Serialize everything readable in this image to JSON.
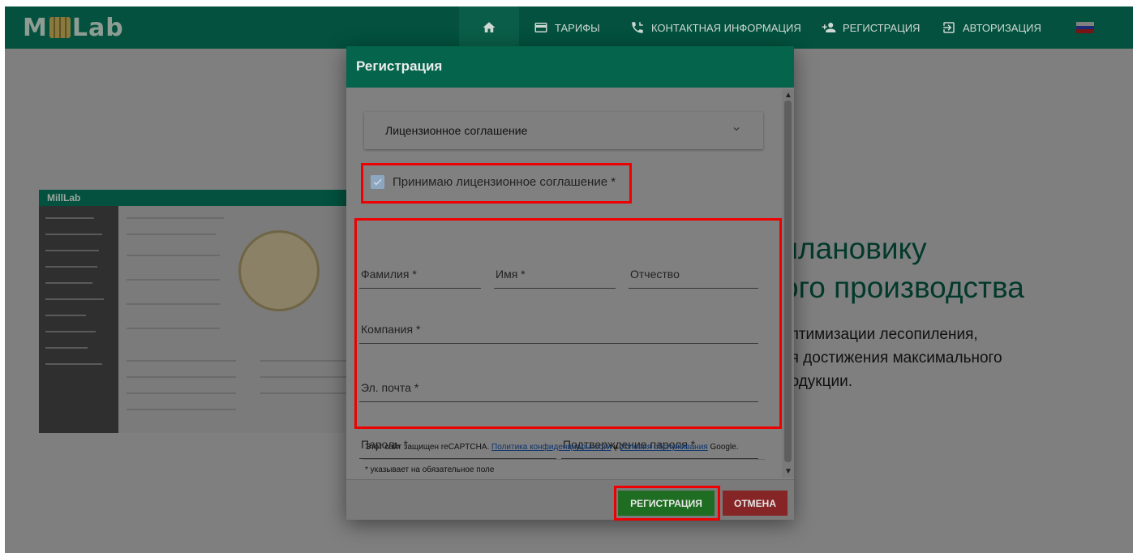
{
  "navbar": {
    "logo": "MillLab",
    "items": [
      {
        "label": "ТАРИФЫ"
      },
      {
        "label": "КОНТАКТНАЯ ИНФОРМАЦИЯ"
      },
      {
        "label": "РЕГИСТРАЦИЯ"
      },
      {
        "label": "АВТОРИЗАЦИЯ"
      }
    ],
    "language": "ru"
  },
  "hero": {
    "title_line1": "плановику",
    "title_line2": "ого производства",
    "sub_line1": "оптимизации лесопиления,",
    "sub_line2": "ия достижения максимального",
    "sub_line3": "родукции."
  },
  "modal": {
    "title": "Регистрация",
    "accordion_label": "Лицензионное соглашение",
    "agree_label": "Принимаю лицензионное соглашение *",
    "agree_checked": true,
    "fields": {
      "last_name": "Фамилия *",
      "first_name": "Имя *",
      "middle_name": "Отчество",
      "company": "Компания *",
      "email": "Эл. почта *",
      "password": "Пароль *",
      "password_confirm": "Подтверждение пароля *"
    },
    "recaptcha_prefix": "Этот сайт защищен reCAPTCHA.",
    "privacy_link": "Политика конфиденциальности",
    "and": "и",
    "terms_link": "Условия обслуживания",
    "recaptcha_suffix": "Google.",
    "required_note": "* указывает на обязательное поле",
    "register_button": "РЕГИСТРАЦИЯ",
    "cancel_button": "ОТМЕНА"
  },
  "colors": {
    "navbar": "#03513e",
    "modal_header": "#04644c",
    "register_button": "#1f6d22",
    "cancel_button": "#862525",
    "highlight": "#ee0000",
    "overlay": "#7f7f7f"
  }
}
